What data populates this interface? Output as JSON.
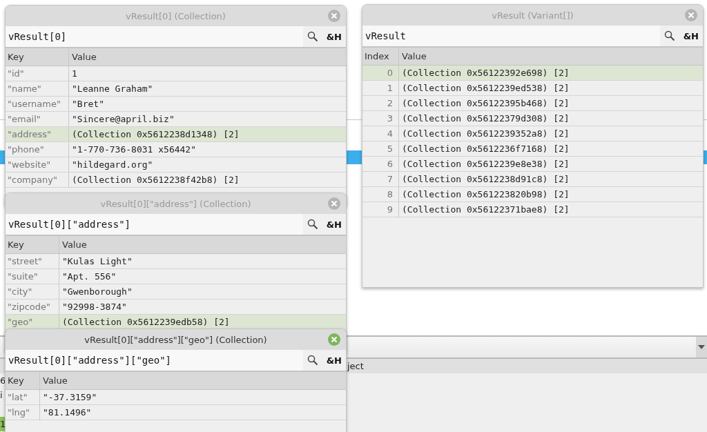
{
  "background": {
    "panel_header": "ject",
    "row_fragments": [
      {
        "text": "6",
        "selected": false
      },
      {
        "text": "i",
        "selected": false
      },
      {
        "text": "1",
        "selected": true
      }
    ]
  },
  "windows": [
    {
      "title": "vResult[0] (Collection)",
      "kind": "collection",
      "active": false,
      "path": "vResult[0]",
      "hex_button": "&H",
      "key_header": "Key",
      "value_header": "Value",
      "rows": [
        {
          "key": "\"id\"",
          "value": "1",
          "selected": false
        },
        {
          "key": "\"name\"",
          "value": "\"Leanne Graham\"",
          "selected": false
        },
        {
          "key": "\"username\"",
          "value": "\"Bret\"",
          "selected": false
        },
        {
          "key": "\"email\"",
          "value": "\"Sincere@april.biz\"",
          "selected": false
        },
        {
          "key": "\"address\"",
          "value": "(Collection 0x5612238d1348) [2]",
          "selected": true
        },
        {
          "key": "\"phone\"",
          "value": "\"1-770-736-8031 x56442\"",
          "selected": false
        },
        {
          "key": "\"website\"",
          "value": "\"hildegard.org\"",
          "selected": false
        },
        {
          "key": "\"company\"",
          "value": "(Collection 0x5612238f42b8) [2]",
          "selected": false
        }
      ]
    },
    {
      "title": "vResult (Variant[])",
      "kind": "array",
      "active": false,
      "path": "vResult",
      "hex_button": "&H",
      "key_header": "Index",
      "value_header": "Value",
      "rows": [
        {
          "key": "0",
          "value": "(Collection 0x56122392e698) [2]",
          "selected": true
        },
        {
          "key": "1",
          "value": "(Collection 0x5612239ed538) [2]",
          "selected": false
        },
        {
          "key": "2",
          "value": "(Collection 0x56122395b468) [2]",
          "selected": false
        },
        {
          "key": "3",
          "value": "(Collection 0x56122379d308) [2]",
          "selected": false
        },
        {
          "key": "4",
          "value": "(Collection 0x5612239352a8) [2]",
          "selected": false
        },
        {
          "key": "5",
          "value": "(Collection 0x5612236f7168) [2]",
          "selected": false
        },
        {
          "key": "6",
          "value": "(Collection 0x5612239e8e38) [2]",
          "selected": false
        },
        {
          "key": "7",
          "value": "(Collection 0x5612238d91c8) [2]",
          "selected": false
        },
        {
          "key": "8",
          "value": "(Collection 0x561223820b98) [2]",
          "selected": false
        },
        {
          "key": "9",
          "value": "(Collection 0x56122371bae8) [2]",
          "selected": false
        }
      ]
    },
    {
      "title": "vResult[0][\"address\"] (Collection)",
      "kind": "collection",
      "active": false,
      "path": "vResult[0][\"address\"]",
      "hex_button": "&H",
      "key_header": "Key",
      "value_header": "Value",
      "rows": [
        {
          "key": "\"street\"",
          "value": "\"Kulas Light\"",
          "selected": false
        },
        {
          "key": "\"suite\"",
          "value": "\"Apt. 556\"",
          "selected": false
        },
        {
          "key": "\"city\"",
          "value": "\"Gwenborough\"",
          "selected": false
        },
        {
          "key": "\"zipcode\"",
          "value": "\"92998-3874\"",
          "selected": false
        },
        {
          "key": "\"geo\"",
          "value": "(Collection 0x5612239edb58) [2]",
          "selected": true
        }
      ]
    },
    {
      "title": "vResult[0][\"address\"][\"geo\"] (Collection)",
      "kind": "collection",
      "active": true,
      "path": "vResult[0][\"address\"][\"geo\"]",
      "hex_button": "&H",
      "key_header": "Key",
      "value_header": "Value",
      "rows": [
        {
          "key": "\"lat\"",
          "value": "\"-37.3159\"",
          "selected": false
        },
        {
          "key": "\"lng\"",
          "value": "\"81.1496\"",
          "selected": false
        }
      ]
    }
  ]
}
